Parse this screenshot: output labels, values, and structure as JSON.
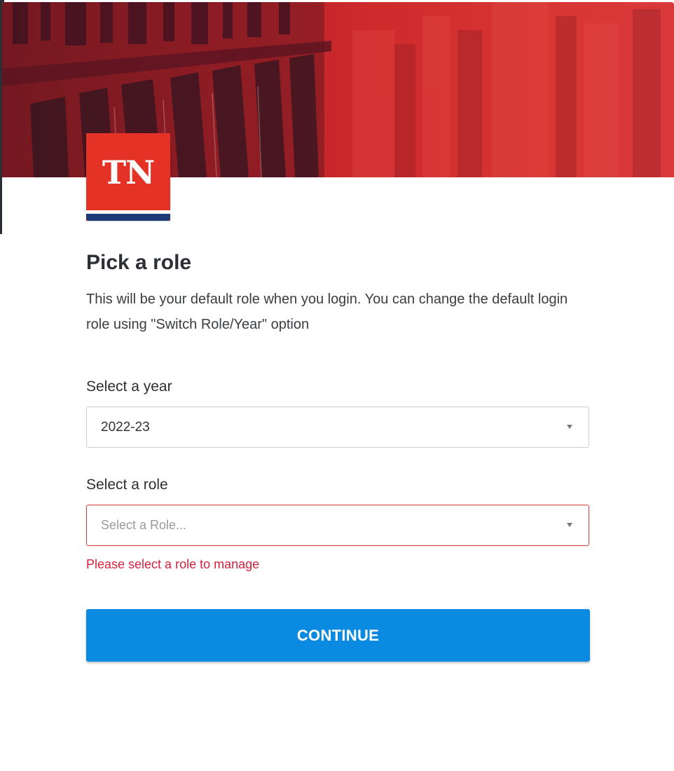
{
  "brand": {
    "logo_text": "TN",
    "logo_color": "#e43226",
    "logo_stripe_color": "#1d3a78"
  },
  "dialog": {
    "title": "Pick a role",
    "description": "This will be your default role when you login. You can change the default login role using \"Switch Role/Year\" option"
  },
  "year_field": {
    "label": "Select a year",
    "value": "2022-23"
  },
  "role_field": {
    "label": "Select a role",
    "placeholder": "Select a Role...",
    "error": "Please select a role to manage",
    "error_color": "#d3223a"
  },
  "continue_button": {
    "label": "CONTINUE",
    "color": "#0a8ae0"
  }
}
